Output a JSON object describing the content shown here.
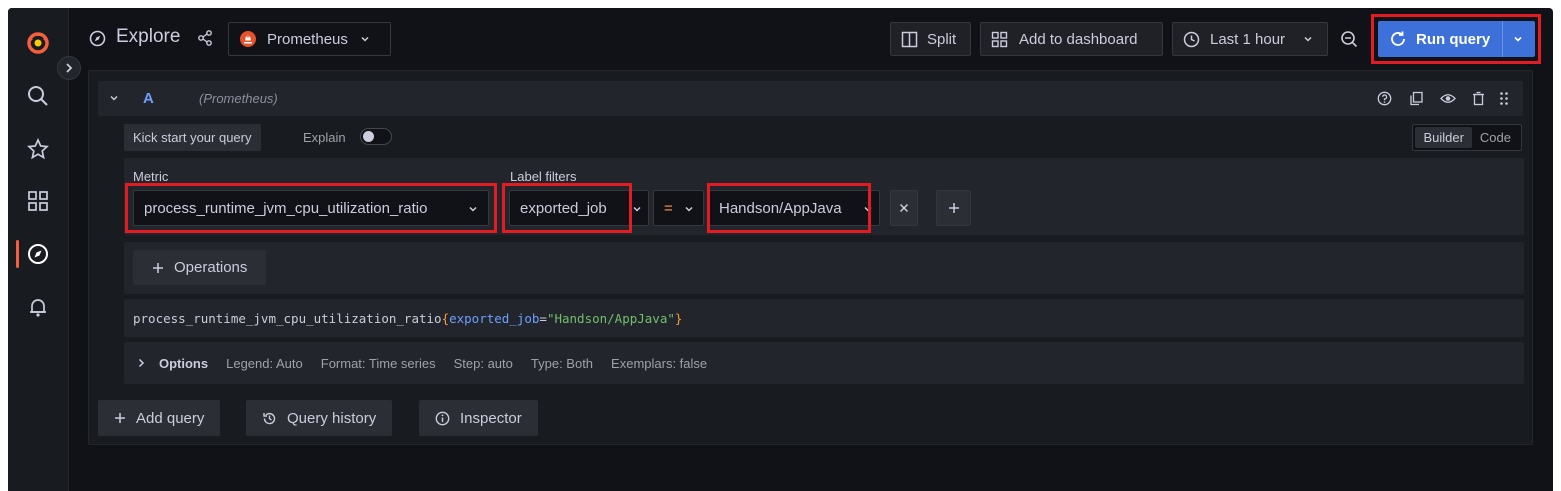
{
  "header": {
    "title": "Explore",
    "datasource": "Prometheus",
    "split_label": "Split",
    "add_dashboard_label": "Add to dashboard",
    "time_range_label": "Last 1 hour",
    "run_query_label": "Run query"
  },
  "query": {
    "letter": "A",
    "datasource_hint": "(Prometheus)",
    "kick_start_label": "Kick start your query",
    "explain_label": "Explain",
    "explain_enabled": false,
    "mode_builder": "Builder",
    "mode_code": "Code",
    "active_mode": "Builder",
    "metric_label": "Metric",
    "metric_value": "process_runtime_jvm_cpu_utilization_ratio",
    "label_filters_label": "Label filters",
    "filter_key": "exported_job",
    "filter_op": "=",
    "filter_value": "Handson/AppJava",
    "operations_label": "Operations",
    "promql_metric": "process_runtime_jvm_cpu_utilization_ratio",
    "promql_open": "{",
    "promql_key": "exported_job",
    "promql_eq": "=",
    "promql_value": "\"Handson/AppJava\"",
    "promql_close": "}",
    "options_label": "Options",
    "options_legend": "Legend: Auto",
    "options_format": "Format: Time series",
    "options_step": "Step: auto",
    "options_type": "Type: Both",
    "options_exemplars": "Exemplars: false"
  },
  "footer": {
    "add_query_label": "Add query",
    "query_history_label": "Query history",
    "inspector_label": "Inspector"
  },
  "colors": {
    "accent": "#3d71d9",
    "highlight": "#e31c24",
    "grafana_orange": "#f55f3e"
  }
}
